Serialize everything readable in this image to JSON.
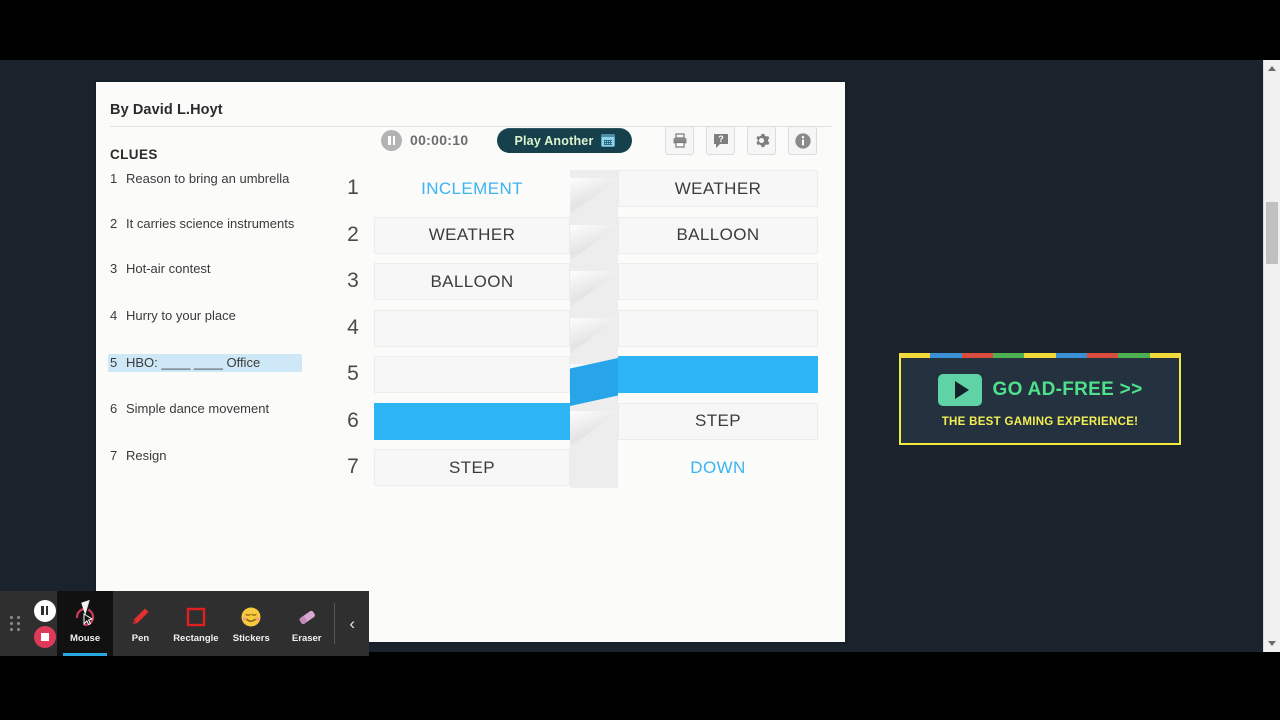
{
  "page": {
    "byline": "By David L.Hoyt",
    "clues_heading": "CLUES",
    "clues": [
      {
        "num": "1",
        "text": "Reason to bring an umbrella",
        "active": false
      },
      {
        "num": "2",
        "text": "It carries science instruments",
        "active": false
      },
      {
        "num": "3",
        "text": "Hot-air contest",
        "active": false
      },
      {
        "num": "4",
        "text": "Hurry to your place",
        "active": false
      },
      {
        "num": "5",
        "text": "HBO: ____ ____ Office",
        "active": true
      },
      {
        "num": "6",
        "text": "Simple dance movement",
        "active": false
      },
      {
        "num": "7",
        "text": "Resign",
        "active": false
      }
    ]
  },
  "toolbar": {
    "pause_icon": "pause-icon",
    "timer": "00:00:10",
    "play_another_label": "Play Another",
    "calendar_icon": "calendar-icon",
    "buttons": [
      {
        "name": "print-button",
        "icon": "printer-icon"
      },
      {
        "name": "help-button",
        "icon": "question-bubble-icon"
      },
      {
        "name": "settings-button",
        "icon": "gear-icon"
      },
      {
        "name": "info-button",
        "icon": "info-icon"
      }
    ]
  },
  "board": {
    "row_numbers": [
      "1",
      "2",
      "3",
      "4",
      "5",
      "6",
      "7"
    ],
    "left_column": [
      {
        "text": "INCLEMENT",
        "state": "solved-blue"
      },
      {
        "text": "WEATHER",
        "state": "filled"
      },
      {
        "text": "BALLOON",
        "state": "filled"
      },
      {
        "text": "",
        "state": "empty"
      },
      {
        "text": "",
        "state": "empty"
      },
      {
        "text": "",
        "state": "highlight"
      },
      {
        "text": "STEP",
        "state": "filled"
      }
    ],
    "right_column": [
      {
        "text": "WEATHER",
        "state": "filled"
      },
      {
        "text": "BALLOON",
        "state": "filled"
      },
      {
        "text": "",
        "state": "empty"
      },
      {
        "text": "",
        "state": "empty"
      },
      {
        "text": "",
        "state": "highlight"
      },
      {
        "text": "STEP",
        "state": "filled"
      },
      {
        "text": "DOWN",
        "state": "solved-blue"
      }
    ]
  },
  "ad": {
    "headline": "GO AD-FREE >>",
    "subline": "THE BEST GAMING EXPERIENCE!",
    "play_icon": "play-icon",
    "stripe_colors": [
      "#f2d93c",
      "#3b8fd4",
      "#d94b3c",
      "#4caf50",
      "#f2d93c",
      "#3b8fd4",
      "#d94b3c",
      "#4caf50",
      "#f2d93c"
    ]
  },
  "scrollbar": {
    "up_icon": "scroll-up-arrow-icon",
    "down_icon": "scroll-down-arrow-icon"
  },
  "recorder": {
    "grip_icon": "drag-grip-icon",
    "pause_icon": "pause-icon",
    "stop_icon": "stop-icon",
    "tools": [
      {
        "label": "Mouse",
        "icon": "mouse-cursor-icon",
        "active": true
      },
      {
        "label": "Pen",
        "icon": "pen-icon",
        "active": false
      },
      {
        "label": "Rectangle",
        "icon": "rectangle-icon",
        "active": false
      },
      {
        "label": "Stickers",
        "icon": "smiley-sticker-icon",
        "active": false
      },
      {
        "label": "Eraser",
        "icon": "eraser-icon",
        "active": false
      }
    ],
    "collapse_label": "‹"
  },
  "colors": {
    "accent_blue": "#2db4f5",
    "connector_blue": "#28a5e8",
    "clue_highlight": "#cfe8f7",
    "page_bg": "#1a222c",
    "button_dark": "#15404c",
    "ad_green": "#4ee08a",
    "ad_yellow": "#f4ee52"
  }
}
